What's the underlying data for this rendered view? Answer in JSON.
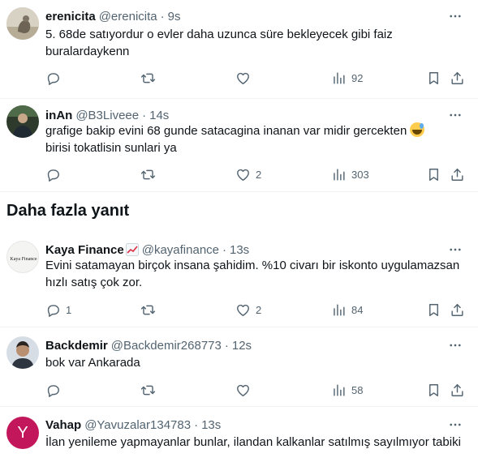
{
  "section_heading": "Daha fazla yanıt",
  "tweets": [
    {
      "name": "erenicita",
      "handle": "@erenicita",
      "time": "9s",
      "text": "5. 68de satıyordur o evler daha uzunca süre bekleyecek gibi faiz buralardaykenn",
      "reply_count": "",
      "retweet_count": "",
      "like_count": "",
      "view_count": "92"
    },
    {
      "name": "inAn",
      "handle": "@B3Liveee",
      "time": "14s",
      "text": "grafige bakip evini 68 gunde satacagina inanan var midir gercekten",
      "text2": "birisi tokatlisin sunlari ya",
      "emoji": "grinning-face-with-sweat",
      "reply_count": "",
      "retweet_count": "",
      "like_count": "2",
      "view_count": "303"
    },
    {
      "name": "Kaya Finance",
      "name_emoji": "chart-increasing",
      "handle": "@kayafinance",
      "time": "13s",
      "avatar_text": "Kaya Finance",
      "text": "Evini satamayan birçok insana şahidim. %10 civarı bir iskonto uygulamazsan hızlı satış çok zor.",
      "reply_count": "1",
      "retweet_count": "",
      "like_count": "2",
      "view_count": "84"
    },
    {
      "name": "Backdemir",
      "handle": "@Backdemir268773",
      "time": "12s",
      "text": "bok var Ankarada",
      "reply_count": "",
      "retweet_count": "",
      "like_count": "",
      "view_count": "58"
    },
    {
      "name": "Vahap",
      "handle": "@Yavuzalar134783",
      "time": "13s",
      "avatar_letter": "Y",
      "text": "İlan yenileme yapmayanlar bunlar, ilandan kalkanlar satılmış sayılmıyor tabiki"
    }
  ],
  "colors": {
    "text": "#0f1419",
    "muted": "#536471",
    "divider": "#eff3f4",
    "vahap_avatar": "#c2185b"
  },
  "icons": [
    "more-icon",
    "reply-icon",
    "retweet-icon",
    "like-icon",
    "views-icon",
    "bookmark-icon",
    "share-icon"
  ]
}
